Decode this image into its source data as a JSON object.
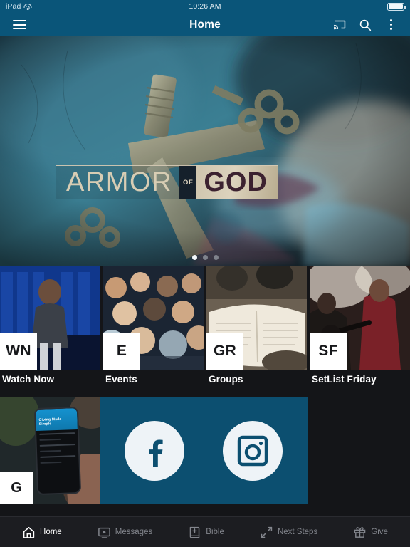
{
  "status_bar": {
    "device": "iPad",
    "wifi_icon": "wifi-icon",
    "time": "10:26 AM",
    "battery_icon": "battery-full-icon"
  },
  "app_bar": {
    "menu_icon": "hamburger-menu-icon",
    "title": "Home",
    "cast_icon": "cast-icon",
    "search_icon": "search-icon",
    "overflow_icon": "more-vertical-icon",
    "background_color": "#0a5579"
  },
  "hero": {
    "title_part1": "ARMOR",
    "title_part2": "OF",
    "title_part3": "GOD",
    "alt": "Sword hilt and keys on teal textured background",
    "carousel": {
      "total": 3,
      "active_index": 0
    }
  },
  "tiles": [
    {
      "badge": "WN",
      "label": "Watch Now"
    },
    {
      "badge": "E",
      "label": "Events"
    },
    {
      "badge": "GR",
      "label": "Groups"
    },
    {
      "badge": "SF",
      "label": "SetList Friday"
    }
  ],
  "promo": {
    "give": {
      "badge": "G",
      "phone_headline": "Giving Made Simple"
    },
    "social": {
      "background_color": "#0c4f70",
      "items": [
        {
          "icon": "facebook-icon",
          "name": "Facebook"
        },
        {
          "icon": "instagram-icon",
          "name": "Instagram"
        }
      ]
    }
  },
  "tab_bar": {
    "background_color": "#1c1d21",
    "active_color": "#ffffff",
    "inactive_color": "#83868d",
    "items": [
      {
        "label": "Home",
        "icon": "home-icon",
        "active": true
      },
      {
        "label": "Messages",
        "icon": "messages-icon",
        "active": false
      },
      {
        "label": "Bible",
        "icon": "bible-icon",
        "active": false
      },
      {
        "label": "Next Steps",
        "icon": "next-steps-icon",
        "active": false
      },
      {
        "label": "Give",
        "icon": "gift-icon",
        "active": false
      }
    ]
  }
}
